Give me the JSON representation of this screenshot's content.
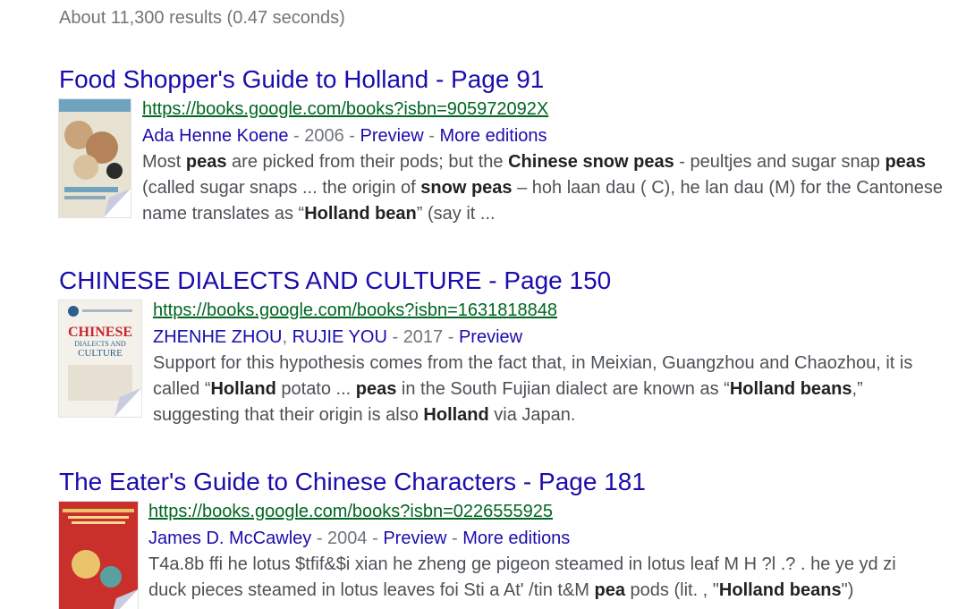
{
  "results_stats": "About 11,300 results (0.47 seconds)",
  "results": [
    {
      "title": "Food Shopper's Guide to Holland - Page 91",
      "url": "https://books.google.com/books?isbn=905972092X",
      "authors": [
        "Ada Henne Koene"
      ],
      "year": "2006",
      "preview_label": "Preview",
      "more_editions_label": "More editions",
      "snippet": [
        [
          "Most ",
          ""
        ],
        [
          "peas",
          "b"
        ],
        [
          " are picked from their pods; but the ",
          ""
        ],
        [
          "Chinese snow peas",
          "b"
        ],
        [
          " - peultjes and sugar snap ",
          ""
        ],
        [
          "peas",
          "b"
        ],
        [
          " (called sugar snaps ... the origin of ",
          ""
        ],
        [
          "snow peas",
          "b"
        ],
        [
          " – hoh laan dau ( C), he lan dau (M) for the Cantonese name translates as “",
          ""
        ],
        [
          "Holland bean",
          "b"
        ],
        [
          "” (say it ...",
          ""
        ]
      ],
      "thumbnail_colors": [
        "#6fa3c0",
        "#c9a37a",
        "#e8e2d2"
      ]
    },
    {
      "title": "CHINESE DIALECTS AND CULTURE - Page 150",
      "url": "https://books.google.com/books?isbn=1631818848",
      "authors": [
        "ZHENHE ZHOU",
        "RUJIE YOU"
      ],
      "year": "2017",
      "preview_label": "Preview",
      "more_editions_label": "",
      "snippet": [
        [
          "Support for this hypothesis comes from the fact that, in Meixian, Guangzhou and Chaozhou, it is called “",
          ""
        ],
        [
          "Holland",
          "b"
        ],
        [
          " potato ... ",
          ""
        ],
        [
          "peas",
          "b"
        ],
        [
          " in the South Fujian dialect are known as “",
          ""
        ],
        [
          "Holland beans",
          "b"
        ],
        [
          ",” suggesting that their origin is also ",
          ""
        ],
        [
          "Holland",
          "b"
        ],
        [
          " via Japan.",
          ""
        ]
      ],
      "thumbnail_text": {
        "line1": "CHINESE",
        "line2": "DIALECTS AND",
        "line3": "CULTURE"
      },
      "thumbnail_colors": [
        "#f4f1ea",
        "#c8262b",
        "#2e5f8c"
      ]
    },
    {
      "title": "The Eater's Guide to Chinese Characters - Page 181",
      "url": "https://books.google.com/books?isbn=0226555925",
      "authors": [
        "James D. McCawley"
      ],
      "year": "2004",
      "preview_label": "Preview",
      "more_editions_label": "More editions",
      "snippet": [
        [
          "T4a.8b ffi he lotus $tfif&$i xian he zheng ge pigeon steamed in lotus leaf M H ?l .? . he ye yd zi duck pieces steamed in lotus leaves foi Sti a At' /tin t&M ",
          ""
        ],
        [
          "pea",
          "b"
        ],
        [
          " pods (lit. , \"",
          ""
        ],
        [
          "Holland beans",
          "b"
        ],
        [
          "\")",
          ""
        ]
      ],
      "thumbnail_colors": [
        "#c9302c",
        "#e9c46a",
        "#5aa0a0"
      ]
    }
  ]
}
